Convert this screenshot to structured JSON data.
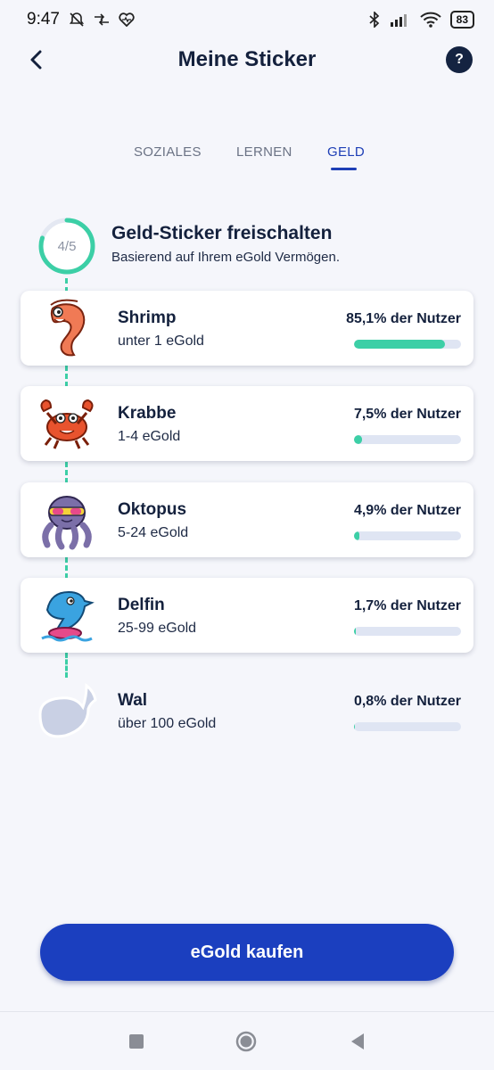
{
  "status_bar": {
    "time": "9:47",
    "battery": "83"
  },
  "header": {
    "title": "Meine Sticker",
    "help_label": "?"
  },
  "tabs": [
    {
      "label": "SOZIALES",
      "active": false
    },
    {
      "label": "LERNEN",
      "active": false
    },
    {
      "label": "GELD",
      "active": true
    }
  ],
  "progress": {
    "count_label": "4/5",
    "unlocked": 4,
    "total": 5,
    "title": "Geld-Sticker freischalten",
    "subtitle": "Basierend auf Ihrem eGold Vermögen."
  },
  "stickers": [
    {
      "name": "Shrimp",
      "range": "unter 1 eGold",
      "percent_label": "85,1% der Nutzer",
      "percent": 85.1,
      "unlocked": true,
      "icon": "shrimp-icon"
    },
    {
      "name": "Krabbe",
      "range": "1-4 eGold",
      "percent_label": "7,5% der Nutzer",
      "percent": 7.5,
      "unlocked": true,
      "icon": "crab-icon"
    },
    {
      "name": "Oktopus",
      "range": "5-24 eGold",
      "percent_label": "4,9% der Nutzer",
      "percent": 4.9,
      "unlocked": true,
      "icon": "octopus-icon"
    },
    {
      "name": "Delfin",
      "range": "25-99 eGold",
      "percent_label": "1,7% der Nutzer",
      "percent": 1.7,
      "unlocked": true,
      "icon": "dolphin-icon"
    },
    {
      "name": "Wal",
      "range": "über 100 eGold",
      "percent_label": "0,8% der Nutzer",
      "percent": 0.8,
      "unlocked": false,
      "icon": "whale-icon"
    }
  ],
  "buy_button": {
    "label": "eGold kaufen"
  },
  "colors": {
    "accent": "#1b3fbf",
    "progress": "#3ccfa6",
    "title": "#14213d"
  }
}
